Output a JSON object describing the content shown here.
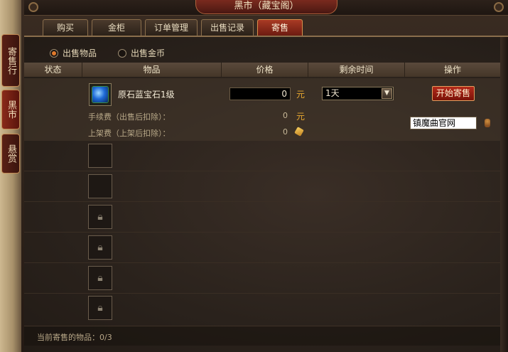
{
  "window": {
    "title": "黑市（藏宝阁）"
  },
  "side_tabs": [
    {
      "label": "寄售行",
      "active": false
    },
    {
      "label": "黑市",
      "active": true
    },
    {
      "label": "悬赏",
      "active": false
    }
  ],
  "tabs": [
    {
      "label": "购买",
      "active": false
    },
    {
      "label": "金柜",
      "active": false
    },
    {
      "label": "订单管理",
      "active": false
    },
    {
      "label": "出售记录",
      "active": false
    },
    {
      "label": "寄售",
      "active": true
    }
  ],
  "sell_type": {
    "options": [
      {
        "label": "出售物品",
        "selected": true
      },
      {
        "label": "出售金币",
        "selected": false
      }
    ]
  },
  "table": {
    "columns": [
      "状态",
      "物品",
      "价格",
      "剩余时间",
      "操作"
    ]
  },
  "listing": {
    "item_name": "原石蓝宝石1级",
    "item_icon": "blue-gem-icon",
    "price_value": "0",
    "currency": "元",
    "time_value": "1天",
    "start_button": "开始寄售",
    "fee_label": "手续费（出售后扣除）：",
    "fee_value": "0",
    "fee_unit": "元",
    "listing_fee_label": "上架费（上架后扣除）：",
    "listing_fee_value": "0",
    "input_value": "镇魔曲官网"
  },
  "footer": {
    "status": "当前寄售的物品：0/3"
  },
  "colors": {
    "accent_red": "#a83a24",
    "gold": "#e8a830",
    "panel_bg": "#2a221c"
  }
}
